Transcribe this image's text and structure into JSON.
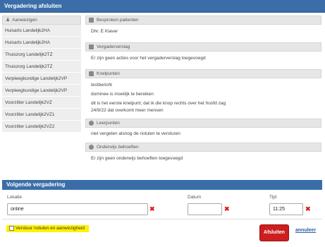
{
  "header": {
    "title": "Vergadering afsluiten"
  },
  "attendees": {
    "heading": "Aanwezigen",
    "people": [
      "Huisarts Landelijk2HA",
      "Huisarts Landelijk2HA",
      "Thuiszorg Landelijk2TZ",
      "Thuiszorg Landelijk2TZ",
      "Verpleegkundige Landelijk2VP",
      "Verpleegkundige Landelijk2VP",
      "Voorzitter Landelijk2VZ",
      "Voorzitter Landelijk2VZ1",
      "Voorzitter Landelijk2VZ2"
    ]
  },
  "sections": {
    "patients": {
      "heading": "Besproken patienten",
      "lines": [
        "Dhr. E Klaver"
      ]
    },
    "report": {
      "heading": "Vergaderverslag",
      "lines": [
        "Er zijn geen acties voor het vergaderverslag toegevoegd"
      ]
    },
    "knelpunten": {
      "heading": "Knelpunten",
      "lines": [
        "testbericht",
        "dominee is moeilijk te bereiken",
        "dit is het eerste knelpunt; dat ik die knop rechts over het hoofd zag",
        "24/9/22 dat overkomt meer mensen"
      ]
    },
    "leerpunten": {
      "heading": "Leerpunten",
      "lines": [
        "niet vergeten alsnog de notulen te versturen"
      ]
    },
    "onderwijs": {
      "heading": "Onderwijs behoeften",
      "lines": [
        "Er zijn geen onderwijs behoeften toegevoegd"
      ]
    }
  },
  "next_meeting": {
    "heading": "Volgende vergadering",
    "location_label": "Lokatie",
    "location_value": "online",
    "date_label": "Datum",
    "date_value": "",
    "time_label": "Tijd",
    "time_value": "11:25"
  },
  "footer": {
    "checkbox_label": "Verstuur notulen en aanwezigheid",
    "checkbox_checked": false,
    "close_button": "Afsluiten",
    "cancel_link": "annuleer"
  },
  "colors": {
    "header_blue": "#3b6ea8",
    "danger_red": "#cc1f1f",
    "highlight_yellow": "#fff200",
    "link_blue": "#2a5fa8"
  }
}
